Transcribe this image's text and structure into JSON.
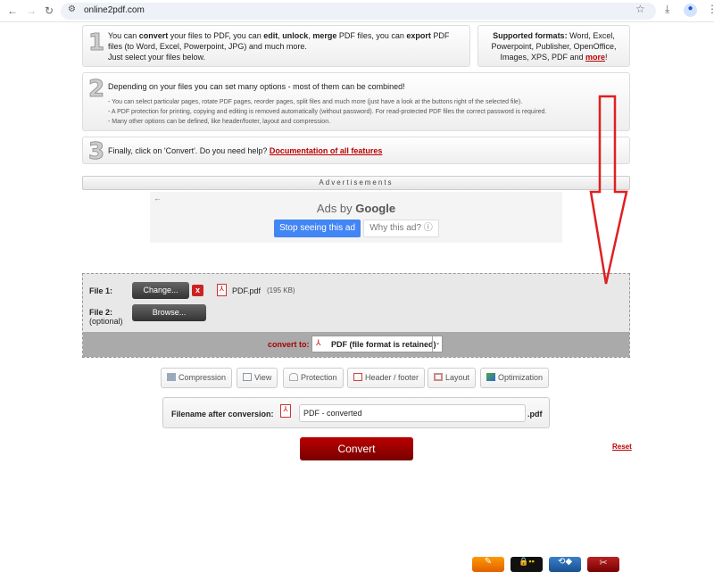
{
  "browser": {
    "url": "online2pdf.com"
  },
  "steps": {
    "s1": {
      "num": "1",
      "pre": "You can ",
      "b1": "convert",
      "m1": " your files to PDF, you can ",
      "b2": "edit",
      "m2": ", ",
      "b3": "unlock",
      "m3": ", ",
      "b4": "merge",
      "m4": " PDF files, you can ",
      "b5": "export",
      "m5": " PDF files (to Word, Excel, Powerpoint, JPG) and much more.",
      "line3": "Just select your files below."
    },
    "formats": {
      "label": "Supported formats:",
      "text": " Word, Excel, Powerpoint, Publisher, OpenOffice, Images, XPS, PDF and ",
      "link": "more",
      "end": "!"
    },
    "s2": {
      "num": "2",
      "title": "Depending on your files you can set many options - most of them can be combined!",
      "lines": [
        "- You can select particular pages, rotate PDF pages, reorder pages, split files and much more (just have a look at the buttons right of the selected file).",
        "- A PDF protection for printing, copying and editing is removed automatically (without password). For read-protected PDF files the correct password is required.",
        "- Many other options can be defined, like header/footer, layout and compression."
      ]
    },
    "s3": {
      "num": "3",
      "text": "Finally, click on 'Convert'. Do you need help? ",
      "link": "Documentation of all features"
    }
  },
  "ads": {
    "bar": "Advertisements",
    "back": "←",
    "ads_by": "Ads by ",
    "google": "Google",
    "stop": "Stop seeing this ad",
    "why": "Why this ad? ⓘ"
  },
  "files": {
    "file1_label": "File 1:",
    "change": "Change...",
    "remove": "x",
    "file_name": "PDF.pdf",
    "file_size": "(195 KB)",
    "file2_label": "File 2:",
    "file2_sub": "(optional)",
    "browse": "Browse...",
    "convert_to_label": "convert to:",
    "convert_to_value": "PDF (file format is retained)"
  },
  "options": [
    "Compression",
    "View",
    "Protection",
    "Header / footer",
    "Layout",
    "Optimization"
  ],
  "filename": {
    "label": "Filename after conversion:",
    "value": "PDF - converted",
    "ext": ".pdf"
  },
  "convert": "Convert",
  "reset": "Reset",
  "colors": {
    "accent": "#a00000",
    "annotation_arrow": "#e02020"
  }
}
